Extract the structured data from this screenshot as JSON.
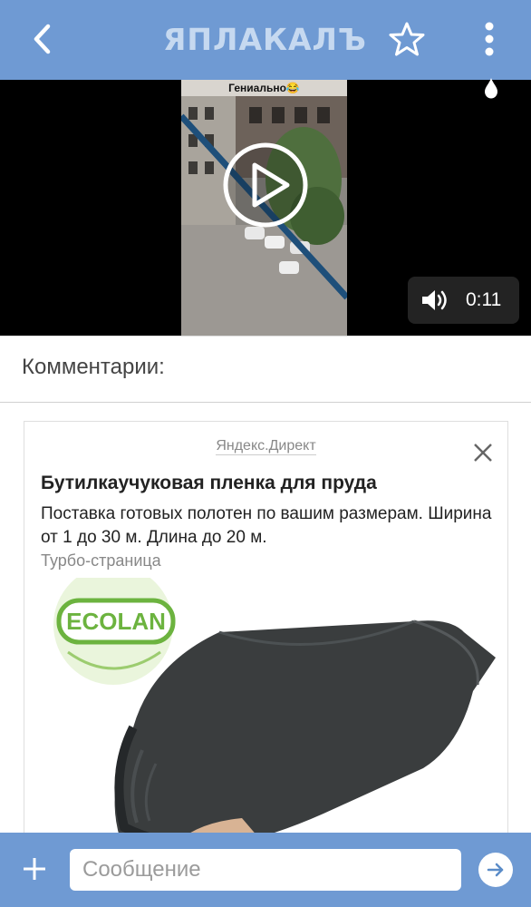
{
  "header": {
    "logo_text": "ЯПЛАКАЛЪ",
    "back_icon": "chevron-left-icon",
    "favorite_icon": "star-icon",
    "menu_icon": "more-vertical-icon",
    "bar_color": "#6f9ad3"
  },
  "video": {
    "caption": "Гениально😂",
    "duration": "0:11",
    "play_icon": "play-icon",
    "volume_icon": "volume-icon"
  },
  "comments": {
    "title": "Комментарии:"
  },
  "ad": {
    "source": "Яндекс.Директ",
    "title": "Бутилкаучуковая пленка для пруда",
    "text": "Поставка готовых полотен по вашим размерам. Ширина от 1 до 30 м. Длина до 20 м.",
    "domain": "Турбо-страница",
    "brand": "ECOLAN",
    "close_icon": "close-icon"
  },
  "composer": {
    "placeholder": "Сообщение",
    "add_icon": "plus-icon",
    "send_icon": "arrow-right-icon"
  }
}
